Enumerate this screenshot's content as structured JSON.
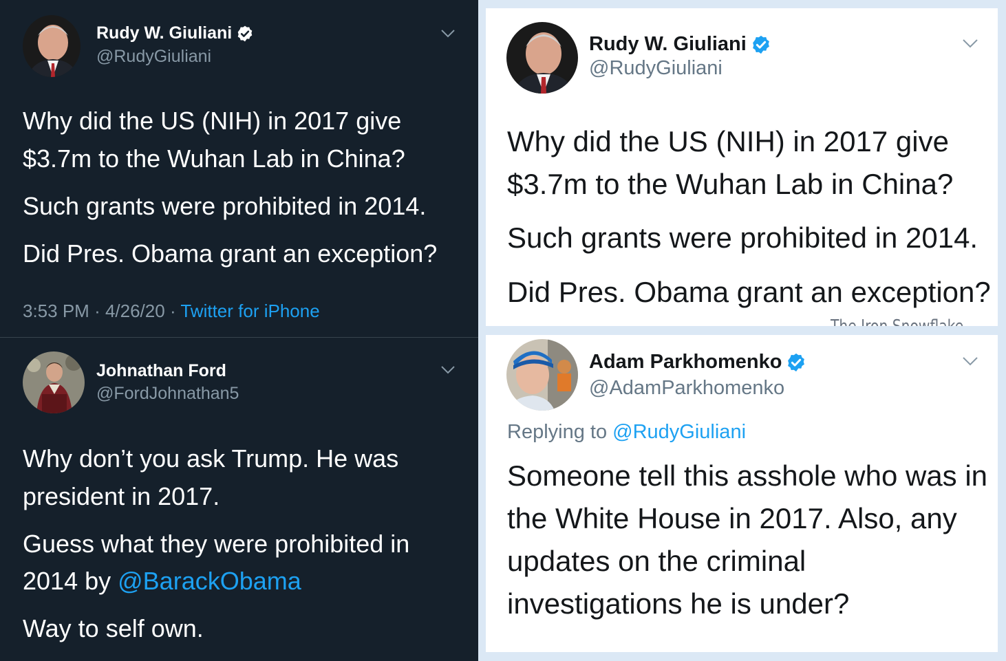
{
  "colors": {
    "dark_bg": "#15202b",
    "light_bg": "#ffffff",
    "link": "#1da1f2",
    "verified": "#1da1f2"
  },
  "tweet1": {
    "name": "Rudy W. Giuliani",
    "handle": "@RudyGiuliani",
    "lines": [
      "Why did the US (NIH) in 2017 give",
      "$3.7m to the Wuhan Lab in China?",
      "Such grants were prohibited in 2014.",
      "Did Pres. Obama grant an exception?"
    ],
    "time": "3:53 PM",
    "date": "4/26/20",
    "source": "Twitter for iPhone"
  },
  "tweet2": {
    "name": "Johnathan Ford",
    "handle": "@FordJohnathan5",
    "lines": [
      "Why don’t you ask Trump. He was",
      "president in 2017.",
      "Guess what they were prohibited in",
      "2014 by ",
      "Way to self own."
    ],
    "mention": "@BarackObama"
  },
  "tweet3": {
    "name": "Rudy W. Giuliani",
    "handle": "@RudyGiuliani",
    "lines": [
      "Why did the US (NIH) in 2017 give",
      "$3.7m to the Wuhan Lab in China?",
      "Such grants were prohibited in 2014.",
      "Did Pres. Obama grant an exception?"
    ],
    "watermark": "The Iron Snowflake"
  },
  "tweet4": {
    "name": "Adam Parkhomenko",
    "handle": "@AdamParkhomenko",
    "replying_prefix": "Replying to ",
    "replying_to": "@RudyGiuliani",
    "lines": [
      "Someone tell this asshole who was in",
      "the White House in 2017. Also, any",
      "updates on the criminal",
      "investigations he is under?"
    ]
  }
}
